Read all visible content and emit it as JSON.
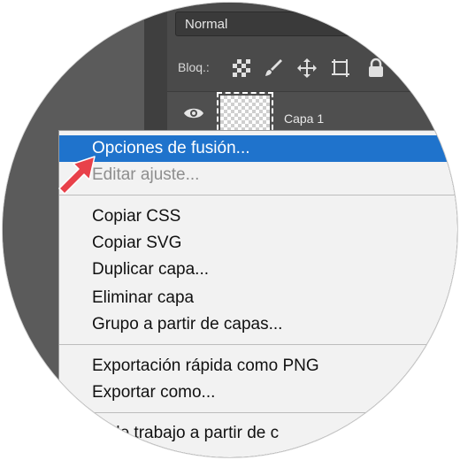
{
  "blend_mode": "Normal",
  "lock": {
    "label": "Bloq.:",
    "icons": [
      "lock-transparent-pixels-icon",
      "brush-icon",
      "move-icon",
      "artboard-icon",
      "lock-icon"
    ]
  },
  "layer": {
    "name": "Capa 1"
  },
  "context_menu": {
    "items": [
      {
        "label": "Opciones de fusión...",
        "state": "highlighted"
      },
      {
        "label": "Editar ajuste...",
        "state": "disabled"
      },
      {
        "label": "Copiar CSS",
        "state": "normal"
      },
      {
        "label": "Copiar SVG",
        "state": "normal"
      },
      {
        "label": "Duplicar capa...",
        "state": "normal"
      },
      {
        "label": "Eliminar capa",
        "state": "normal"
      },
      {
        "label": "Grupo a partir de capas...",
        "state": "normal"
      },
      {
        "label": "Exportación rápida como PNG",
        "state": "normal"
      },
      {
        "label": "Exportar como...",
        "state": "normal"
      },
      {
        "label": "de trabajo a partir de c",
        "state": "normal"
      }
    ]
  },
  "colors": {
    "highlight": "#1f73cc",
    "arrow": "#e8414a"
  }
}
